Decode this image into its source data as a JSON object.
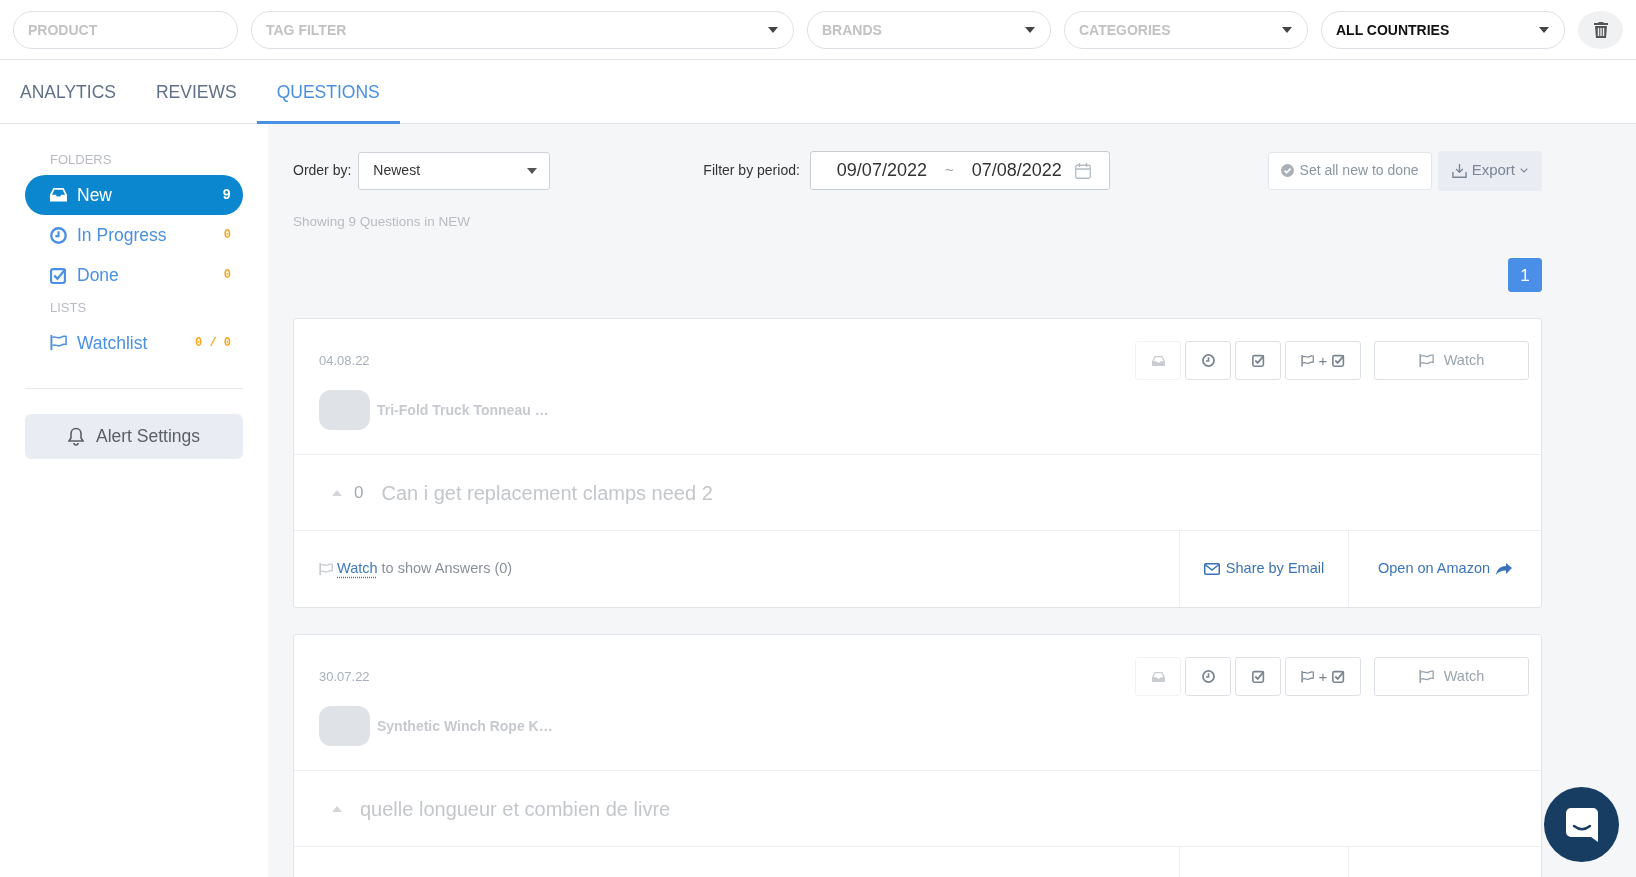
{
  "filters": [
    {
      "kind": "text",
      "placeholder": "PRODUCT"
    },
    {
      "kind": "select",
      "placeholder": "TAG FILTER"
    },
    {
      "kind": "select",
      "placeholder": "BRANDS"
    },
    {
      "kind": "select",
      "placeholder": "CATEGORIES"
    },
    {
      "kind": "select",
      "value": "ALL COUNTRIES"
    }
  ],
  "tabs": [
    {
      "label": "ANALYTICS",
      "selected": false
    },
    {
      "label": "REVIEWS",
      "selected": false
    },
    {
      "label": "QUESTIONS",
      "selected": true
    }
  ],
  "sidebar": {
    "sections": [
      {
        "heading": "FOLDERS",
        "items": [
          {
            "label": "New",
            "count": "9",
            "selected": true
          },
          {
            "label": "In Progress",
            "count": "0",
            "selected": false
          },
          {
            "label": "Done",
            "count": "0",
            "selected": false
          }
        ]
      },
      {
        "heading": "LISTS",
        "items": [
          {
            "label": "Watchlist",
            "count": "0 / 0",
            "selected": false
          }
        ]
      }
    ],
    "alert_button": "Alert Settings"
  },
  "toolbar": {
    "order_label": "Order by:",
    "order_value": "Newest",
    "period_label": "Filter by period:",
    "date_from": "09/07/2022",
    "date_separator": "~",
    "date_to": "07/08/2022",
    "done_button": "Set all new to done",
    "export_button": "Export"
  },
  "summary": "Showing 9 Questions in NEW",
  "pagination": [
    {
      "label": "1",
      "selected": true
    }
  ],
  "questions": [
    {
      "date": "04.08.22",
      "actions": [
        {
          "disabled": true
        },
        {
          "disabled": false
        },
        {
          "disabled": false
        },
        {
          "disabled": false,
          "label": "+"
        }
      ],
      "watch_button": "Watch",
      "product": "Tri-Fold Truck Tonneau …",
      "votes": "0",
      "text": "Can i get replacement clamps need 2",
      "footer": {
        "watch_link": "Watch",
        "answers_text": "to show Answers (0)",
        "share": "Share by Email",
        "open": "Open on Amazon"
      }
    },
    {
      "date": "30.07.22",
      "actions": [
        {
          "disabled": true
        },
        {
          "disabled": false
        },
        {
          "disabled": false
        },
        {
          "disabled": false,
          "label": "+"
        }
      ],
      "watch_button": "Watch",
      "product": "Synthetic Winch Rope K…",
      "text": "quelle longueur et combien de livre"
    }
  ]
}
